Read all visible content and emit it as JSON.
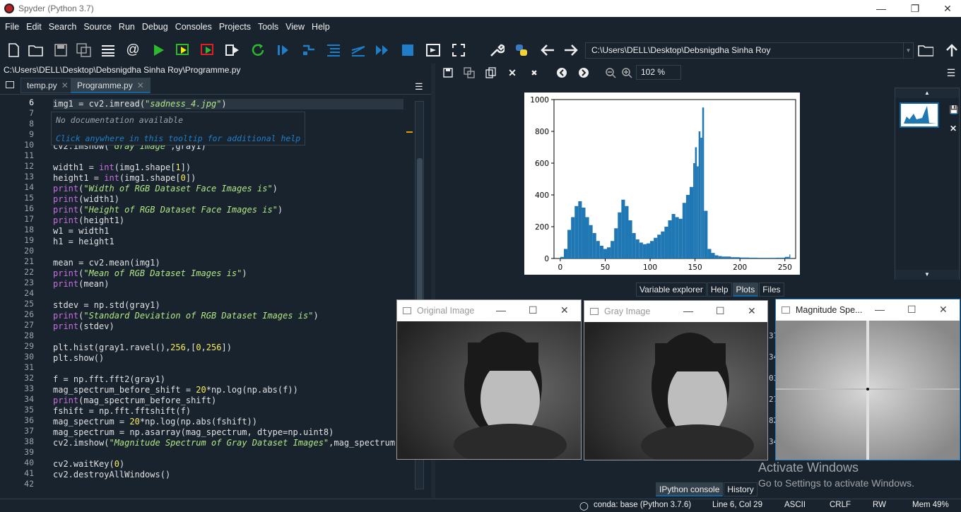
{
  "window": {
    "title": "Spyder (Python 3.7)"
  },
  "menu": [
    "File",
    "Edit",
    "Search",
    "Source",
    "Run",
    "Debug",
    "Consoles",
    "Projects",
    "Tools",
    "View",
    "Help"
  ],
  "toolbar": {
    "working_dir": "C:\\Users\\DELL\\Desktop\\Debsnigdha Sinha Roy"
  },
  "editor": {
    "file_path": "C:\\Users\\DELL\\Desktop\\Debsnigdha Sinha Roy\\Programme.py",
    "tabs": [
      {
        "label": "temp.py"
      },
      {
        "label": "Programme.py"
      }
    ],
    "line_numbers": [
      "6",
      "7",
      "8",
      "9",
      "10",
      "11",
      "12",
      "13",
      "14",
      "15",
      "16",
      "17",
      "18",
      "19",
      "20",
      "21",
      "22",
      "23",
      "24",
      "25",
      "26",
      "27",
      "28",
      "29",
      "30",
      "31",
      "32",
      "33",
      "34",
      "35",
      "36",
      "37",
      "38",
      "39",
      "40",
      "41",
      "42"
    ],
    "lines": [
      "img1 = cv2.imread(\"sadness_4.jpg\")",
      "",
      "",
      "",
      "cv2.imshow(\"Gray Image\",gray1)",
      "",
      "width1 = int(img1.shape[1])",
      "height1 = int(img1.shape[0])",
      "print(\"Width of RGB Dataset Face Images is\")",
      "print(width1)",
      "print(\"Height of RGB Dataset Face Images is\")",
      "print(height1)",
      "w1 = width1",
      "h1 = height1",
      "",
      "mean = cv2.mean(img1)",
      "print(\"Mean of RGB Dataset Images is\")",
      "print(mean)",
      "",
      "stdev = np.std(gray1)",
      "print(\"Standard Deviation of RGB Dataset Images is\")",
      "print(stdev)",
      "",
      "plt.hist(gray1.ravel(),256,[0,256])",
      "plt.show()",
      "",
      "f = np.fft.fft2(gray1)",
      "mag_spectrum_before_shift = 20*np.log(np.abs(f))",
      "print(mag_spectrum_before_shift)",
      "fshift = np.fft.fftshift(f)",
      "mag_spectrum = 20*np.log(np.abs(fshift))",
      "mag_spectrum = np.asarray(mag_spectrum, dtype=np.uint8)",
      "cv2.imshow(\"Magnitude Spectrum of Gray Dataset Images\",mag_spectrum)",
      "",
      "cv2.waitKey(0)",
      "cv2.destroyAllWindows()",
      ""
    ],
    "tooltip": {
      "line1": "No documentation available",
      "line2": "Click anywhere in this tooltip for additional help"
    }
  },
  "plots": {
    "zoom": "102 %",
    "tabs": [
      "Variable explorer",
      "Help",
      "Plots",
      "Files"
    ]
  },
  "chart_data": {
    "type": "bar",
    "title": "",
    "xlabel": "",
    "ylabel": "",
    "xlim": [
      -7,
      262
    ],
    "ylim": [
      0,
      1000
    ],
    "xticks": [
      0,
      50,
      100,
      150,
      200,
      250
    ],
    "yticks": [
      0,
      200,
      400,
      600,
      800,
      1000
    ],
    "color": "#1f77b4",
    "x": [
      0,
      4,
      8,
      12,
      16,
      20,
      24,
      28,
      32,
      36,
      40,
      44,
      48,
      52,
      56,
      60,
      64,
      68,
      72,
      76,
      80,
      84,
      88,
      92,
      96,
      100,
      104,
      108,
      112,
      116,
      120,
      124,
      128,
      132,
      136,
      140,
      144,
      148,
      150,
      152,
      154,
      156,
      158,
      160,
      164,
      168,
      172,
      176,
      180,
      190,
      200,
      210,
      220,
      230,
      240,
      250,
      255
    ],
    "values": [
      10,
      60,
      180,
      260,
      330,
      360,
      320,
      260,
      210,
      160,
      110,
      80,
      60,
      70,
      110,
      190,
      290,
      370,
      330,
      240,
      160,
      120,
      100,
      90,
      95,
      110,
      130,
      150,
      170,
      200,
      240,
      280,
      260,
      250,
      350,
      400,
      450,
      600,
      700,
      580,
      800,
      760,
      950,
      300,
      60,
      35,
      20,
      15,
      12,
      8,
      6,
      5,
      4,
      4,
      5,
      10,
      25
    ]
  },
  "windows": {
    "original": {
      "title": "Original Image"
    },
    "gray": {
      "title": "Gray Image"
    },
    "magnitude": {
      "title": "Magnitude Spe..."
    }
  },
  "console": {
    "tabs": [
      "IPython console",
      "History"
    ],
    "partial_numbers": [
      "37",
      "34",
      "03",
      "27",
      "82",
      "34"
    ]
  },
  "watermark": {
    "line1": "Activate Windows",
    "line2": "Go to Settings to activate Windows."
  },
  "status": {
    "env": "conda: base (Python 3.7.6)",
    "position": "Line 6, Col 29",
    "encoding": "ASCII",
    "eol": "CRLF",
    "permissions": "RW",
    "memory": "Mem 49%"
  }
}
